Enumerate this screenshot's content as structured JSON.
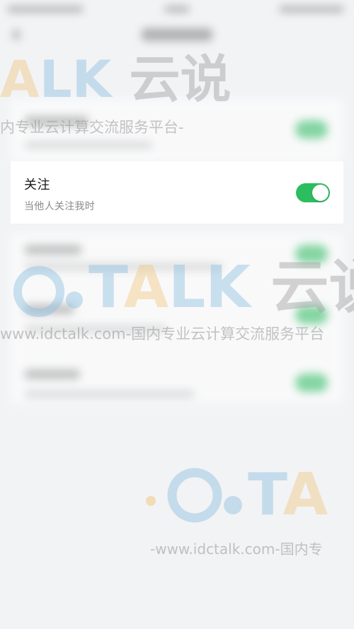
{
  "row": {
    "title": "关注",
    "subtitle": "当他人关注我时",
    "toggle_on": true
  },
  "colors": {
    "toggle_on": "#2bbd5e",
    "background": "#f2f3f5",
    "card": "#ffffff"
  },
  "watermark": {
    "brand_t": "T",
    "brand_a": "A",
    "brand_lk": "LK",
    "brand_cn": "云说",
    "tagline_short": "内专业云计算交流服务平台-",
    "tagline_long": "www.idctalk.com-国内专业云计算交流服务平台",
    "tagline_bottom": "-www.idctalk.com-国内专"
  }
}
